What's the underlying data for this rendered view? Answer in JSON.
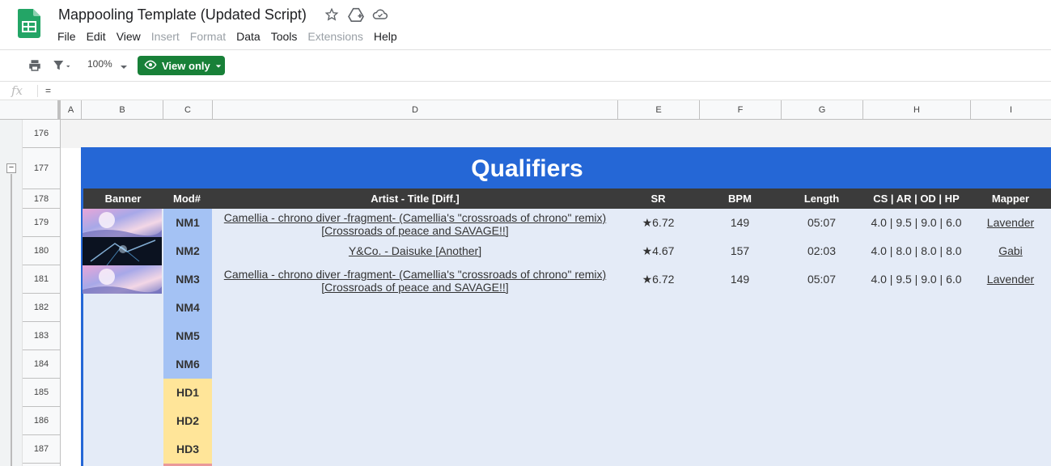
{
  "app": {
    "doc_title": "Mappooling Template (Updated Script)",
    "menu": [
      "File",
      "Edit",
      "View",
      "Insert",
      "Format",
      "Data",
      "Tools",
      "Extensions",
      "Help"
    ],
    "menu_disabled": [
      "Insert",
      "Format",
      "Extensions"
    ]
  },
  "toolbar": {
    "zoom": "100%",
    "view_only_label": "View only"
  },
  "formula_bar": {
    "fx_label": "fx",
    "value": "="
  },
  "columns": [
    "A",
    "B",
    "C",
    "D",
    "E",
    "F",
    "G",
    "H",
    "I"
  ],
  "rows": [
    "176",
    "177",
    "178",
    "179",
    "180",
    "181",
    "182",
    "183",
    "184",
    "185",
    "186",
    "187"
  ],
  "sheet": {
    "section_title": "Qualifiers",
    "headers": {
      "banner": "Banner",
      "mod": "Mod#",
      "title": "Artist - Title [Diff.]",
      "sr": "SR",
      "bpm": "BPM",
      "length": "Length",
      "stats": "CS | AR | OD | HP",
      "mapper": "Mapper"
    },
    "maps": [
      {
        "mod": "NM1",
        "title_line1": "Camellia - chrono diver -fragment- (Camellia's \"crossroads of chrono\" remix)",
        "title_line2": "[Crossroads of peace and SAVAGE!!]",
        "sr": "★6.72",
        "bpm": "149",
        "length": "05:07",
        "stats": "4.0 | 9.5 | 9.0 | 6.0",
        "mapper": "Lavender"
      },
      {
        "mod": "NM2",
        "title_line1": "Y&Co. - Daisuke [Another]",
        "title_line2": "",
        "sr": "★4.67",
        "bpm": "157",
        "length": "02:03",
        "stats": "4.0 | 8.0 | 8.0 | 8.0",
        "mapper": "Gabi"
      },
      {
        "mod": "NM3",
        "title_line1": "Camellia - chrono diver -fragment- (Camellia's \"crossroads of chrono\" remix)",
        "title_line2": "[Crossroads of peace and SAVAGE!!]",
        "sr": "★6.72",
        "bpm": "149",
        "length": "05:07",
        "stats": "4.0 | 9.5 | 9.0 | 6.0",
        "mapper": "Lavender"
      }
    ],
    "empty_slots": [
      "NM4",
      "NM5",
      "NM6",
      "HD1",
      "HD2",
      "HD3"
    ],
    "colors": {
      "title_bar": "#2567d6",
      "header_row": "#3b3b3b",
      "body": "#e4ebf7",
      "nm_slot": "#a4c2f4",
      "hd_slot": "#ffe599",
      "hr_slot": "#ea9999"
    }
  }
}
